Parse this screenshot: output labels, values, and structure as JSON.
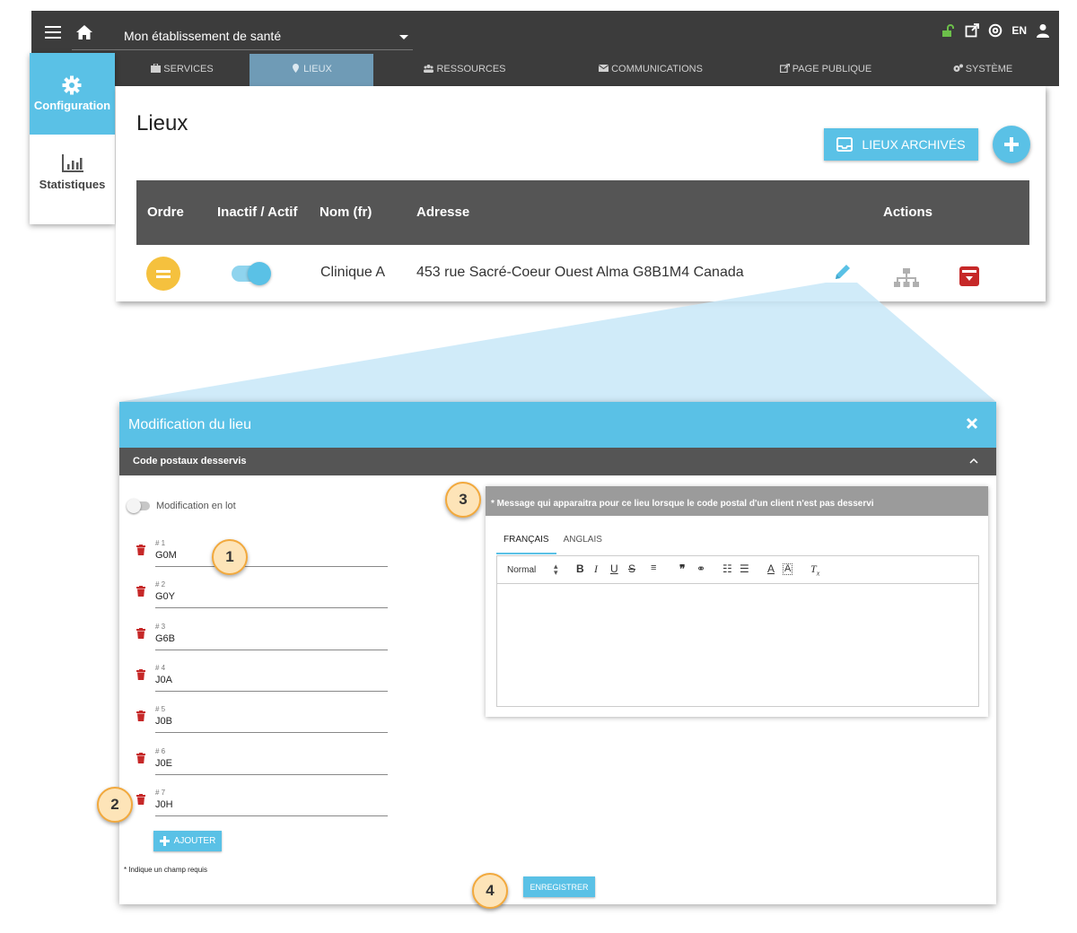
{
  "topbar": {
    "establishment": "Mon établissement de santé",
    "language": "EN"
  },
  "nav": {
    "tabs": [
      {
        "label": "SERVICES",
        "icon": "briefcase-icon"
      },
      {
        "label": "LIEUX",
        "icon": "map-marker-icon",
        "active": true
      },
      {
        "label": "RESSOURCES",
        "icon": "users-icon"
      },
      {
        "label": "COMMUNICATIONS",
        "icon": "envelope-icon"
      },
      {
        "label": "PAGE PUBLIQUE",
        "icon": "external-link-icon"
      },
      {
        "label": "SYSTÈME",
        "icon": "cogs-icon"
      }
    ]
  },
  "side": {
    "configuration": "Configuration",
    "statistics": "Statistiques"
  },
  "lieux": {
    "title": "Lieux",
    "archived_button": "LIEUX ARCHIVÉS",
    "columns": [
      "Ordre",
      "Inactif / Actif",
      "Nom (fr)",
      "Adresse",
      "Actions"
    ],
    "row": {
      "name": "Clinique A",
      "address": "453 rue Sacré-Coeur Ouest Alma G8B1M4 Canada",
      "active": true
    }
  },
  "modal": {
    "title": "Modification du lieu",
    "section": "Code postaux desservis",
    "batch_label": "Modification en lot",
    "postal_codes": [
      {
        "num": "# 1",
        "value": "G0M"
      },
      {
        "num": "# 2",
        "value": "G0Y"
      },
      {
        "num": "# 3",
        "value": "G6B"
      },
      {
        "num": "# 4",
        "value": "J0A"
      },
      {
        "num": "# 5",
        "value": "J0B"
      },
      {
        "num": "# 6",
        "value": "J0E"
      },
      {
        "num": "# 7",
        "value": "J0H"
      }
    ],
    "add_button": "AJOUTER",
    "required_note": "* Indique un champ requis",
    "save_button": "ENREGISTRER",
    "message": {
      "header": "* Message qui apparaitra pour ce lieu lorsque le code postal d'un client n'est pas desservi",
      "tabs": [
        "FRANÇAIS",
        "ANGLAIS"
      ],
      "format": "Normal"
    }
  },
  "badges": [
    "1",
    "2",
    "3",
    "4"
  ],
  "colors": {
    "accent": "#5ac1e6",
    "dark": "#3c3c3c",
    "order_badge": "#f5c13e",
    "archive_red": "#c62828",
    "trash_red": "#c62828",
    "step_badge": "#fde4b8"
  }
}
